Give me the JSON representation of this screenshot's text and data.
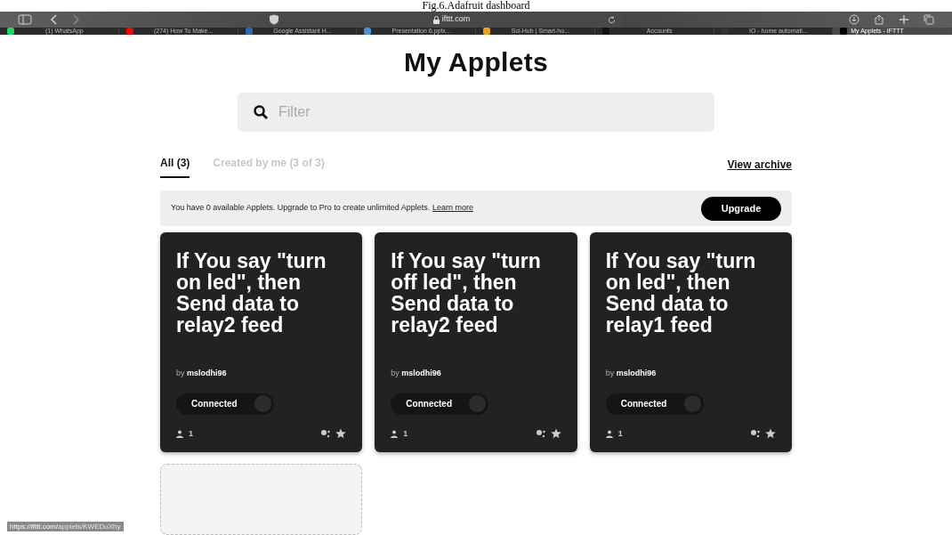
{
  "caption": "Fig.6.Adafruit dashboard",
  "browser": {
    "url": "ifttt.com",
    "tabs": [
      {
        "label": "(1) WhatsApp",
        "selected": false,
        "color": "#25d366"
      },
      {
        "label": "(274) How To Make...",
        "selected": false,
        "color": "#ff0000"
      },
      {
        "label": "Google Assistant H...",
        "selected": false,
        "color": "#2b6cb0"
      },
      {
        "label": "Presentation 6.pptx...",
        "selected": false,
        "color": "#4a90d9"
      },
      {
        "label": "Sci-Hub | Smart-ho...",
        "selected": false,
        "color": "#e8a020"
      },
      {
        "label": "Accounts",
        "selected": false,
        "color": "#111111"
      },
      {
        "label": "IO - home automati...",
        "selected": false,
        "color": "#333333"
      },
      {
        "label": "My Applets - IFTTT",
        "selected": true,
        "color": "#000000"
      }
    ]
  },
  "title": "My Applets",
  "filter": {
    "placeholder": "Filter"
  },
  "tabs": [
    {
      "label": "All (3)",
      "selected": true
    },
    {
      "label": "Created by me (3 of 3)",
      "selected": false
    }
  ],
  "view_archive": "View archive",
  "banner": {
    "text": "You have 0 available Applets. Upgrade to Pro to create unlimited Applets.",
    "link": "Learn more",
    "button": "Upgrade"
  },
  "applets": [
    {
      "title": "If You say \"turn on led\", then Send data to relay2 feed",
      "by": "by",
      "author": "mslodhi96",
      "status": "Connected",
      "users": "1"
    },
    {
      "title": "If You say \"turn off led\", then Send data to relay2 feed",
      "by": "by",
      "author": "mslodhi96",
      "status": "Connected",
      "users": "1"
    },
    {
      "title": "If You say \"turn on led\", then Send data to relay1 feed",
      "by": "by",
      "author": "mslodhi96",
      "status": "Connected",
      "users": "1"
    }
  ],
  "status_link": {
    "host": "https://ifttt.com/",
    "path": "applets/KWEDuXhy"
  }
}
